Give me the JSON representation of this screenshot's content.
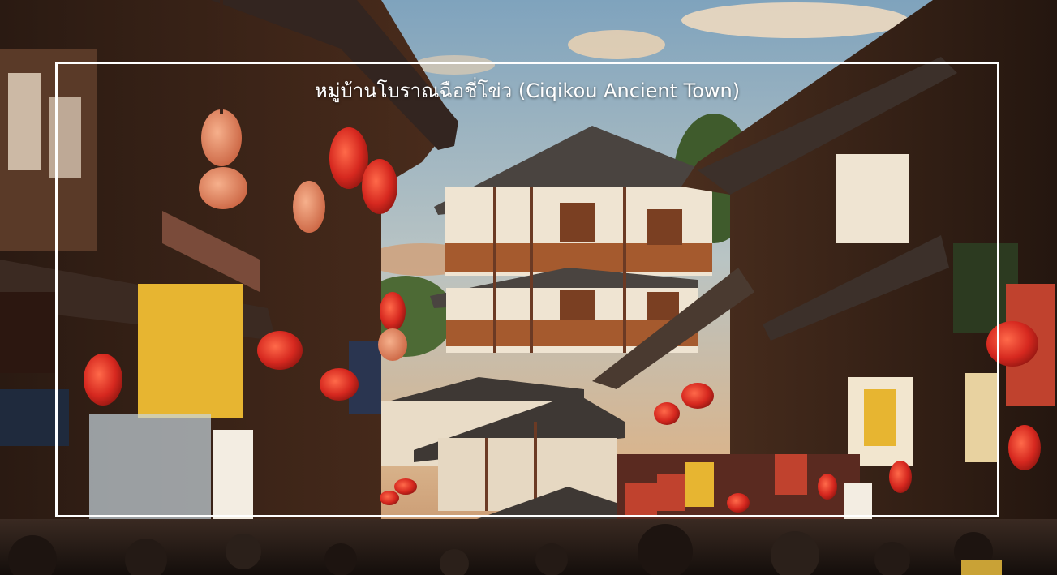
{
  "caption": {
    "text": "หมู่บ้านโบราณฉือชี่โข่ว (Ciqikou Ancient Town)"
  },
  "colors": {
    "frame": "#ffffff",
    "caption_text": "#ffffff",
    "lantern_red": "#d6281f",
    "sign_yellow": "#e7b531",
    "sky_blue": "#8fb2c8",
    "wood_brown": "#6b3a24"
  }
}
